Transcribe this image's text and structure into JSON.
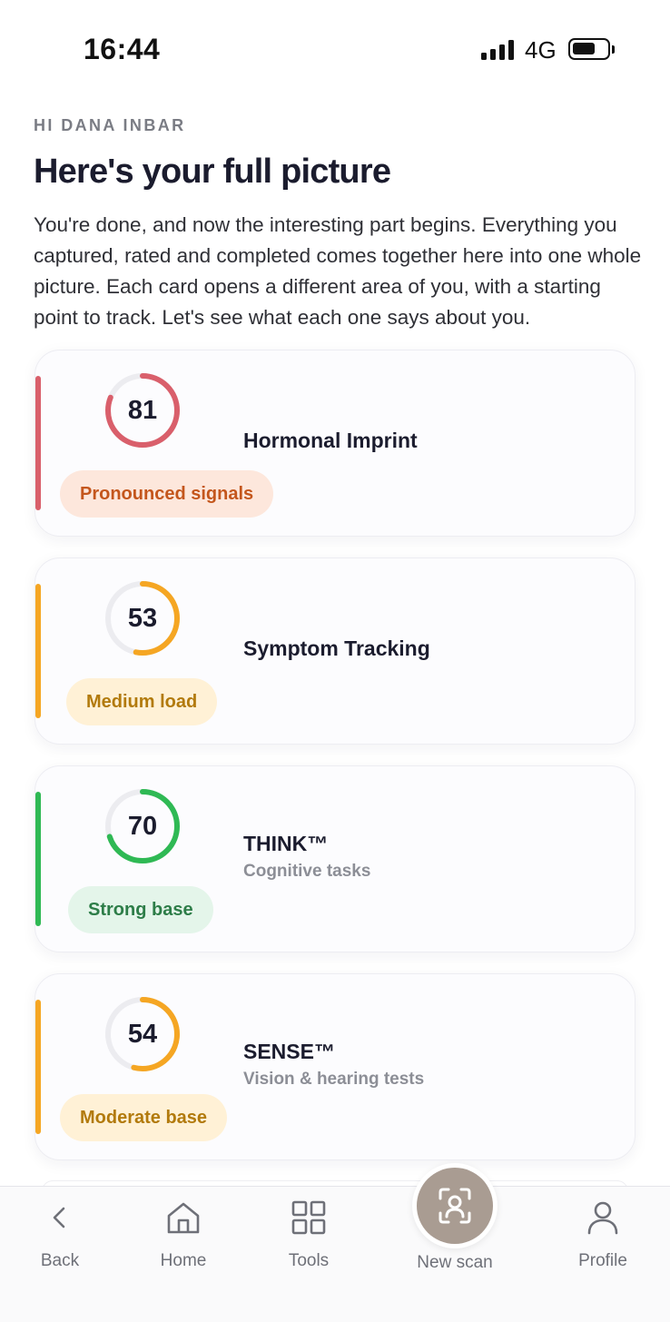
{
  "status_bar": {
    "time": "16:44",
    "network": "4G"
  },
  "header": {
    "greeting": "HI DANA INBAR",
    "title": "Here's your full picture",
    "intro": "You're done, and now the interesting part begins. Everything you captured, rated and completed comes together here into one whole picture. Each card opens a different area of you, with a starting point to track. Let's see what each one says about you."
  },
  "cards": [
    {
      "score": "81",
      "progress": 0.81,
      "title": "Hormonal Imprint",
      "subtitle": "",
      "tag": "Pronounced signals",
      "color": "#d95f6b",
      "tag_bg": "#fde7dc",
      "tag_color": "#c4561c"
    },
    {
      "score": "53",
      "progress": 0.53,
      "title": "Symptom Tracking",
      "subtitle": "",
      "tag": "Medium load",
      "color": "#f5a623",
      "tag_bg": "#fff1d6",
      "tag_color": "#b27a0c"
    },
    {
      "score": "70",
      "progress": 0.7,
      "title": "THINK™",
      "subtitle": "Cognitive tasks",
      "tag": "Strong base",
      "color": "#2fb954",
      "tag_bg": "#e4f5ea",
      "tag_color": "#2d7d48"
    },
    {
      "score": "54",
      "progress": 0.54,
      "title": "SENSE™",
      "subtitle": "Vision & hearing tests",
      "tag": "Moderate base",
      "color": "#f5a623",
      "tag_bg": "#fff1d6",
      "tag_color": "#b27a0c"
    }
  ],
  "nav": {
    "back": "Back",
    "home": "Home",
    "tools": "Tools",
    "scan": "New scan",
    "profile": "Profile"
  },
  "icons": {
    "back": "chevron-left-icon",
    "home": "home-icon",
    "tools": "grid-icon",
    "scan": "face-scan-icon",
    "profile": "person-icon"
  },
  "colors": {
    "scan_button": "#a99c92",
    "track": "#ececf0"
  }
}
